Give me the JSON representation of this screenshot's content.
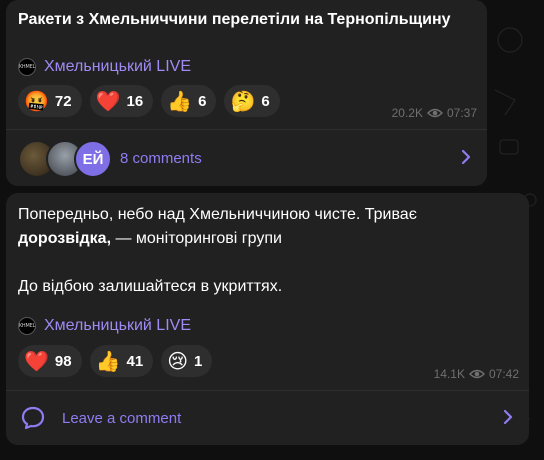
{
  "posts": [
    {
      "text": "Ракети з Хмельниччини перелетіли на Тернопільщину",
      "channel": "Хмельницький LIVE",
      "logo_text": "KHMEL",
      "reactions": [
        {
          "emoji": "🤬",
          "count": "72"
        },
        {
          "emoji": "❤️",
          "count": "16"
        },
        {
          "emoji": "👍",
          "count": "6"
        },
        {
          "emoji": "🤔",
          "count": "6"
        }
      ],
      "views": "20.2K",
      "time": "07:37",
      "avatar3_text": "ЕЙ",
      "comments_label": "8 comments"
    },
    {
      "text_line1": "Попередньо, небо над Хмельниччиною чисте. Триває",
      "text_line2_bold": "дорозвідка,",
      "text_line2_rest": " — моніторингові групи",
      "text_line3": "До відбою залишайтеся в укриттях.",
      "channel": "Хмельницький LIVE",
      "logo_text": "KHMEL",
      "reactions": [
        {
          "emoji": "❤️",
          "count": "98"
        },
        {
          "emoji": "👍",
          "count": "41"
        },
        {
          "emoji": "😢",
          "count": "1"
        }
      ],
      "views": "14.1K",
      "time": "07:42",
      "comments_label": "Leave a comment"
    }
  ],
  "colors": {
    "background": "#0f0f0f",
    "bubble": "#212121",
    "accent": "#8f7cf2",
    "meta": "#6f6f6f"
  }
}
